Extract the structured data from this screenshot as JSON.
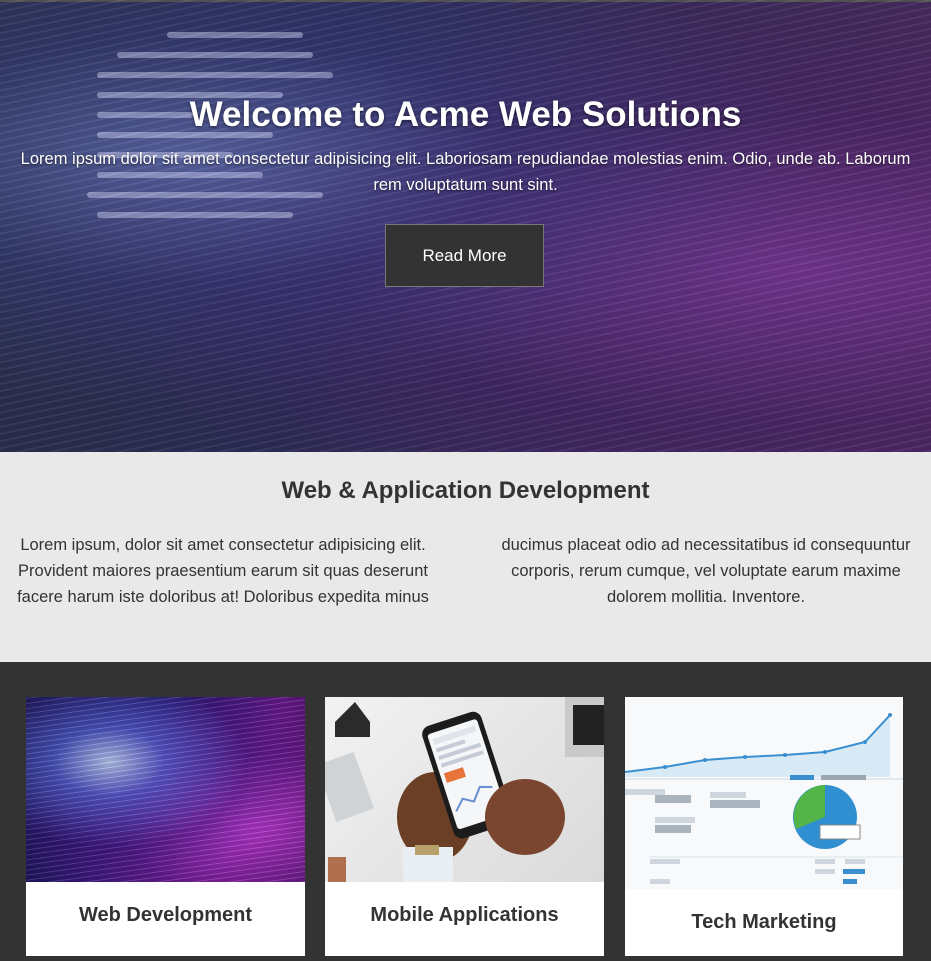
{
  "hero": {
    "title": "Welcome to Acme Web Solutions",
    "text": "Lorem ipsum dolor sit amet consectetur adipisicing elit. Laboriosam repudiandae molestias enim. Odio, unde ab. Laborum rem voluptatum sunt sint.",
    "button_label": "Read More"
  },
  "about": {
    "title": "Web & Application Development",
    "column_left": "Lorem ipsum, dolor sit amet consectetur adipisicing elit. Provident maiores praesentium earum sit quas deserunt facere harum iste doloribus at! Doloribus expedita minus",
    "column_right": "ducimus placeat odio ad necessitatibus id consequuntur corporis, rerum cumque, vel voluptate earum maxime dolorem mollitia. Inventore."
  },
  "services": [
    {
      "label": "Web Development",
      "icon": "code-screen-image"
    },
    {
      "label": "Mobile Applications",
      "icon": "smartphone-hands-image"
    },
    {
      "label": "Tech Marketing",
      "icon": "analytics-dashboard-image"
    }
  ],
  "colors": {
    "dark": "#333333",
    "light": "#e9e9e9",
    "accent_purple": "#6a1a8e",
    "accent_blue": "#2f8fd0"
  }
}
